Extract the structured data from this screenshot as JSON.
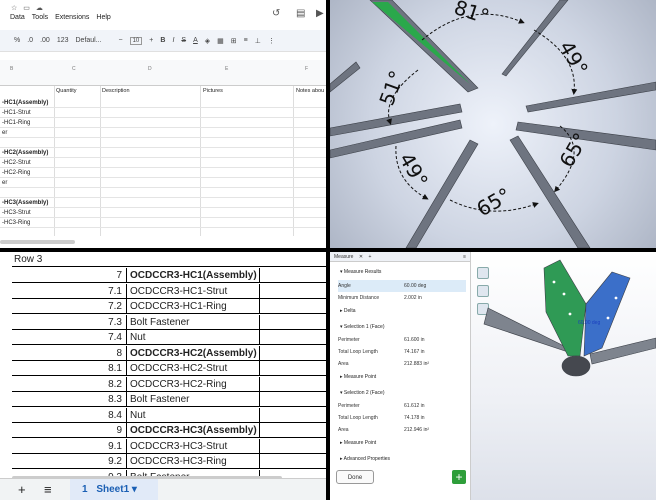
{
  "sheet_small": {
    "menu": [
      "Data",
      "Tools",
      "Extensions",
      "Help"
    ],
    "toolbar": {
      "percent": "%",
      "dec1": ".0",
      "dec2": ".00",
      "fmt123": "123",
      "font": "Defaul...",
      "size": "10",
      "bold": "B",
      "italic": "I",
      "strike": "S",
      "color": "A"
    },
    "col_headers": [
      "B",
      "C",
      "D",
      "E",
      "F"
    ],
    "header_labels": [
      "Quantity",
      "Description",
      "Pictures",
      "Notes abou"
    ],
    "rows": [
      {
        "text": "-HC1(Assembly)",
        "bold": true
      },
      {
        "text": "-HC1-Strut",
        "bold": false
      },
      {
        "text": "-HC1-Ring",
        "bold": false
      },
      {
        "text": "er",
        "bold": false
      },
      {
        "text": "",
        "bold": false
      },
      {
        "text": "-HC2(Assembly)",
        "bold": true
      },
      {
        "text": "-HC2-Strut",
        "bold": false
      },
      {
        "text": "-HC2-Ring",
        "bold": false
      },
      {
        "text": "er",
        "bold": false
      },
      {
        "text": "",
        "bold": false
      },
      {
        "text": "-HC3(Assembly)",
        "bold": true
      },
      {
        "text": "-HC3-Strut",
        "bold": false
      },
      {
        "text": "-HC3-Ring",
        "bold": false
      }
    ]
  },
  "angles": {
    "a81": "81°",
    "a49top": "49°",
    "a51": "51°",
    "a65right": "65°",
    "a49bottom": "49°",
    "a65bottom": "65°"
  },
  "sheet_large": {
    "header_row": "Row 3",
    "rows": [
      {
        "num": "7",
        "text": "OCDCCR3-HC1(Assembly)",
        "bold": true
      },
      {
        "num": "7.1",
        "text": "OCDCCR3-HC1-Strut",
        "bold": false
      },
      {
        "num": "7.2",
        "text": "OCDCCR3-HC1-Ring",
        "bold": false
      },
      {
        "num": "7.3",
        "text": "Bolt Fastener",
        "bold": false
      },
      {
        "num": "7.4",
        "text": "Nut",
        "bold": false
      },
      {
        "num": "8",
        "text": "OCDCCR3-HC2(Assembly)",
        "bold": true
      },
      {
        "num": "8.1",
        "text": "OCDCCR3-HC2-Strut",
        "bold": false
      },
      {
        "num": "8.2",
        "text": "OCDCCR3-HC2-Ring",
        "bold": false
      },
      {
        "num": "8.3",
        "text": "Bolt Fastener",
        "bold": false
      },
      {
        "num": "8.4",
        "text": "Nut",
        "bold": false
      },
      {
        "num": "9",
        "text": "OCDCCR3-HC3(Assembly)",
        "bold": true
      },
      {
        "num": "9.1",
        "text": "OCDCCR3-HC3-Strut",
        "bold": false
      },
      {
        "num": "9.2",
        "text": "OCDCCR3-HC3-Ring",
        "bold": false
      },
      {
        "num": "9.3",
        "text": "Bolt Fastener",
        "bold": false
      }
    ],
    "bottombar": {
      "add": "+",
      "list": "≡",
      "sheet_num": "1",
      "sheet": "Sheet1 ▾"
    }
  },
  "measure": {
    "title": "Measure",
    "results": "Measure Results",
    "angle_label": "Angle",
    "angle_value": "60.00 deg",
    "mindist_label": "Minimum Distance",
    "mindist_value": "2.002 in",
    "delta": "Delta",
    "sel1": "Selection 1 (Face)",
    "p1_label": "Perimeter",
    "p1_value": "61.600 in",
    "tl1_label": "Total Loop Length",
    "tl1_value": "74.167 in",
    "a1_label": "Area",
    "a1_value": "212.883 in²",
    "mp1": "Measure Point",
    "sel2": "Selection 2 (Face)",
    "p2_label": "Perimeter",
    "p2_value": "61.612 in",
    "tl2_label": "Total Loop Length",
    "tl2_value": "74.178 in",
    "a2_label": "Area",
    "a2_value": "212.946 in²",
    "mp2": "Measure Point",
    "adv": "Advanced Properties",
    "done": "Done",
    "plus": "+",
    "viewport_label": "60.00 deg"
  }
}
